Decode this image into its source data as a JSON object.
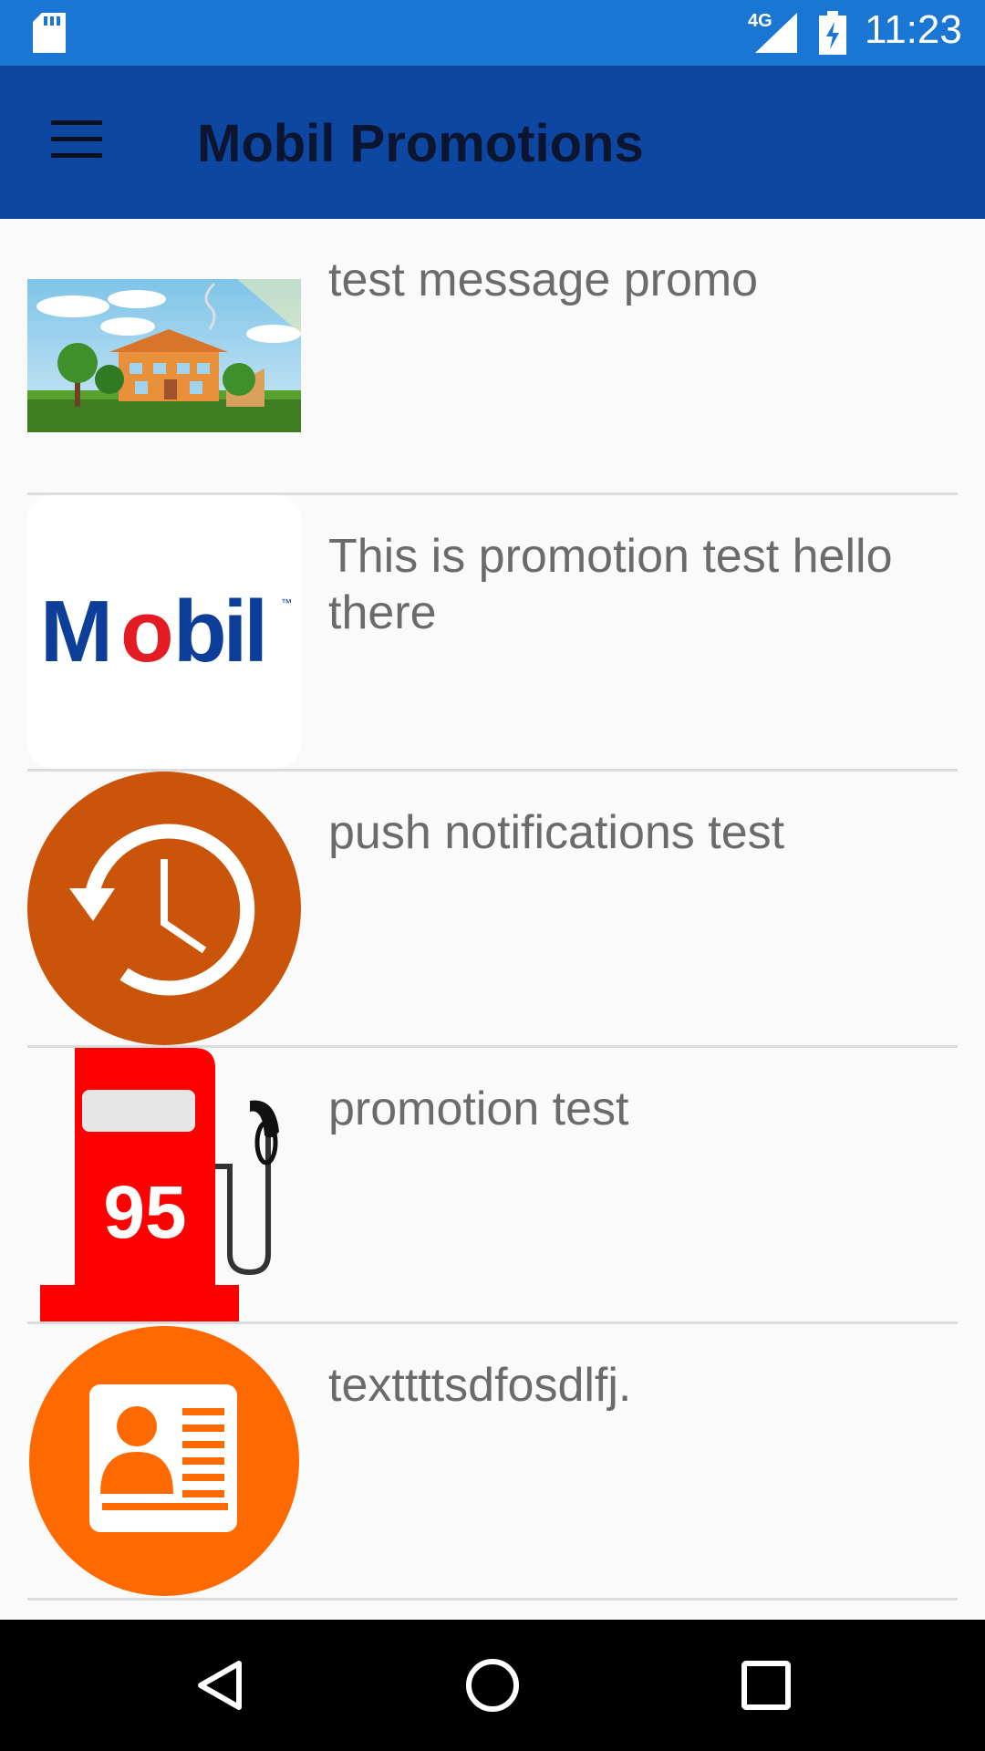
{
  "status_bar": {
    "network": "4G",
    "time": "11:23"
  },
  "app_bar": {
    "title": "Mobil Promotions",
    "menu_icon": "hamburger-menu-icon"
  },
  "promotions": [
    {
      "text": "test message promo",
      "image": "house-landscape-image"
    },
    {
      "text": "This is promotion test hello there",
      "image": "mobil-logo-image",
      "logo_text": "Mobil"
    },
    {
      "text": "push notifications test",
      "image": "history-clock-icon"
    },
    {
      "text": "promotion test",
      "image": "fuel-pump-95-icon",
      "pump_number": "95"
    },
    {
      "text": "texttttsdfosdlfj.",
      "image": "contact-card-icon"
    }
  ],
  "colors": {
    "status_bar": "#1976d2",
    "app_bar": "#0d47a1",
    "list_background": "#fafafa",
    "history_orange": "#c9540a",
    "fuel_red": "#ff0000",
    "contact_orange": "#ff6a00",
    "mobil_blue": "#0c3e9a",
    "mobil_red": "#e31b23"
  },
  "nav_bar": {
    "back_icon": "back-triangle-icon",
    "home_icon": "home-circle-icon",
    "recents_icon": "recents-square-icon"
  }
}
